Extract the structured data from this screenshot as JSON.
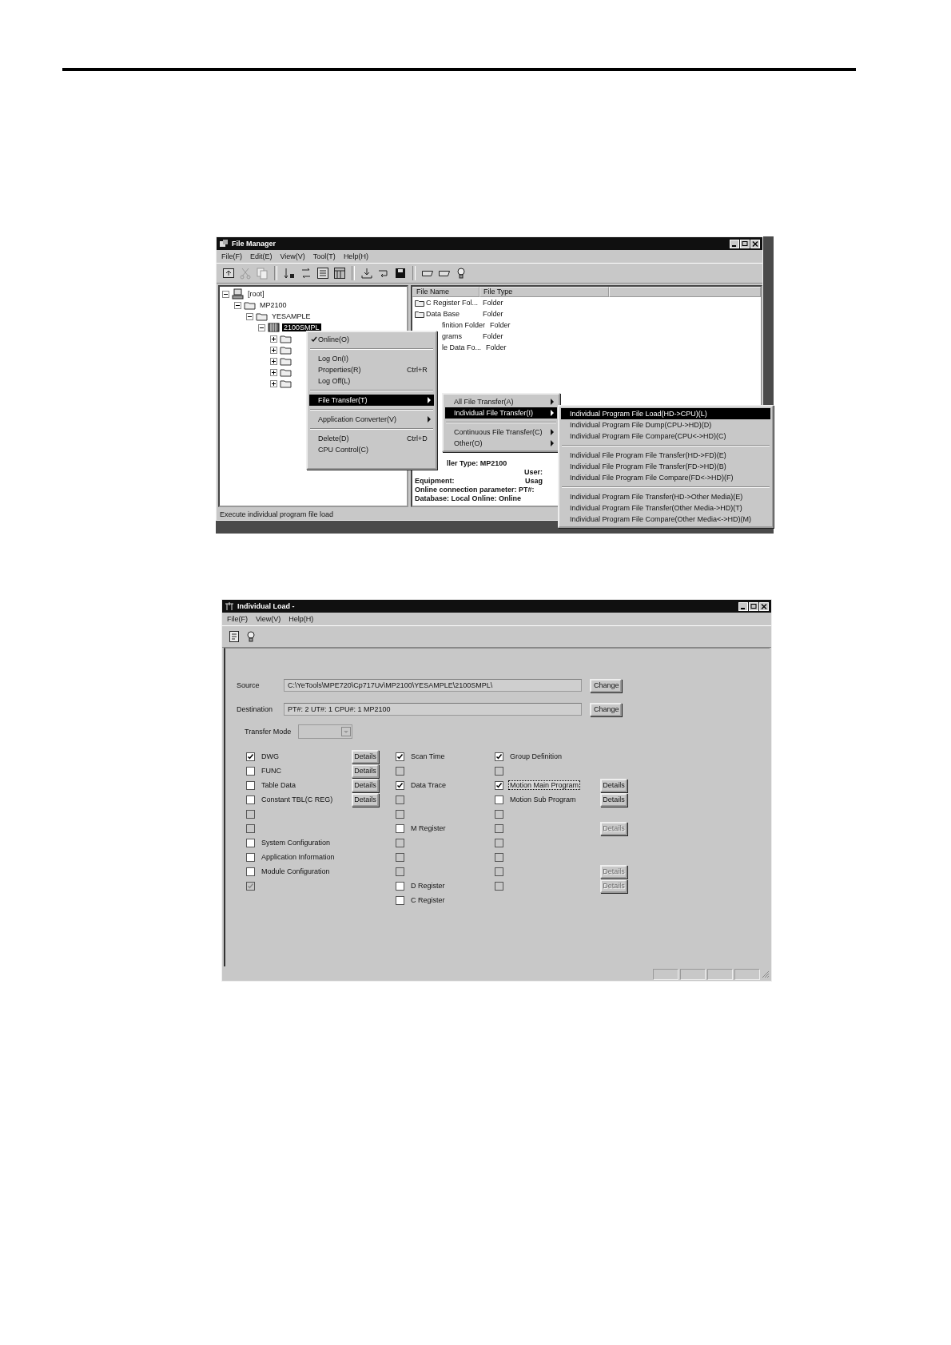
{
  "file_manager": {
    "title": "File Manager",
    "menus": [
      "File(F)",
      "Edit(E)",
      "View(V)",
      "Tool(T)",
      "Help(H)"
    ],
    "tree": [
      {
        "label": "[root]",
        "kind": "computer",
        "expanded": true,
        "children": [
          {
            "label": "MP2100",
            "kind": "folder",
            "expanded": true,
            "children": [
              {
                "label": "YESAMPLE",
                "kind": "folder",
                "expanded": true,
                "children": [
                  {
                    "label": "2100SMPL",
                    "kind": "controller",
                    "selected": true,
                    "expanded": true,
                    "children": [
                      {
                        "kind": "folder",
                        "expanded": false
                      },
                      {
                        "kind": "folder",
                        "expanded": false
                      },
                      {
                        "kind": "folder",
                        "expanded": false
                      },
                      {
                        "kind": "folder",
                        "expanded": false
                      },
                      {
                        "kind": "folder",
                        "expanded": false
                      }
                    ]
                  }
                ]
              }
            ]
          }
        ]
      }
    ],
    "list": {
      "columns": [
        "File Name",
        "File Type"
      ],
      "rows": [
        {
          "name": "C Register Fol...",
          "type": "Folder",
          "kind": "full"
        },
        {
          "name": "Data Base",
          "type": "Folder",
          "kind": "full"
        },
        {
          "name": "finition Folder",
          "type": "Folder",
          "kind": "partial"
        },
        {
          "name": "grams",
          "type": "Folder",
          "kind": "partial"
        },
        {
          "name": "le Data Fo...",
          "type": "Folder",
          "kind": "partial"
        }
      ],
      "info": [
        {
          "left": "ller Type: MP2100",
          "kind": "partial"
        },
        {
          "right": "User:",
          "kind": "partial"
        },
        {
          "left": "Equipment:",
          "right": "Usag",
          "kind": "full"
        },
        {
          "left": "Online connection parameter: PT#:",
          "kind": "full"
        },
        {
          "left": "Database: Local  Online: Online",
          "kind": "full"
        }
      ]
    },
    "context_menu": [
      {
        "kind": "item",
        "label": "Online(O)",
        "checked": true,
        "selected": false
      },
      {
        "kind": "separator"
      },
      {
        "kind": "item",
        "label": "Log On(I)",
        "checked": false,
        "selected": false
      },
      {
        "kind": "item",
        "label": "Properties(R)",
        "shortcut": "Ctrl+R",
        "checked": false,
        "selected": false
      },
      {
        "kind": "item",
        "label": "Log Off(L)",
        "checked": false,
        "selected": false
      },
      {
        "kind": "separator"
      },
      {
        "kind": "submenu",
        "label": "File Transfer(T)",
        "selected": true
      },
      {
        "kind": "separator"
      },
      {
        "kind": "submenu",
        "label": "Application Converter(V)",
        "selected": false
      },
      {
        "kind": "separator"
      },
      {
        "kind": "item",
        "label": "Delete(D)",
        "shortcut": "Ctrl+D",
        "checked": false,
        "selected": false
      },
      {
        "kind": "item",
        "label": "CPU Control(C)",
        "checked": false,
        "selected": false
      },
      {
        "kind": "blank"
      }
    ],
    "transfer_menu": [
      {
        "kind": "submenu",
        "label": "All File Transfer(A)",
        "selected": false
      },
      {
        "kind": "submenu",
        "label": "Individual File Transfer(I)",
        "selected": true
      },
      {
        "kind": "separator"
      },
      {
        "kind": "submenu",
        "label": "Continuous File Transfer(C)",
        "selected": false
      },
      {
        "kind": "submenu",
        "label": "Other(O)",
        "selected": false
      }
    ],
    "individual_menu": [
      {
        "kind": "item",
        "label": "Individual Program File Load(HD->CPU)(L)",
        "selected": true
      },
      {
        "kind": "item",
        "label": "Individual Program File Dump(CPU->HD)(D)",
        "selected": false
      },
      {
        "kind": "item",
        "label": "Individual Program File Compare(CPU<->HD)(C)",
        "selected": false
      },
      {
        "kind": "separator"
      },
      {
        "kind": "item",
        "label": "Individual File Program File Transfer(HD->FD)(E)",
        "selected": false
      },
      {
        "kind": "item",
        "label": "Individual File Program File Transfer(FD->HD)(B)",
        "selected": false
      },
      {
        "kind": "item",
        "label": "Individual File Program File Compare(FD<->HD)(F)",
        "selected": false
      },
      {
        "kind": "separator"
      },
      {
        "kind": "item",
        "label": "Individual Program File Transfer(HD->Other Media)(E)",
        "selected": false
      },
      {
        "kind": "item",
        "label": "Individual Program File Transfer(Other Media->HD)(T)",
        "selected": false
      },
      {
        "kind": "item",
        "label": "Individual Program File Compare(Other Media<->HD)(M)",
        "selected": false
      }
    ],
    "status_bar": "Execute individual program file load"
  },
  "individual_load": {
    "title": "Individual Load -",
    "menus": [
      "File(F)",
      "View(V)",
      "Help(H)"
    ],
    "source": {
      "label": "Source",
      "value": "C:\\YeTools\\MPE720\\Cp717Uv\\MP2100\\YESAMPLE\\2100SMPL\\",
      "button": "Change"
    },
    "destination": {
      "label": "Destination",
      "value": "PT#: 2 UT#: 1 CPU#: 1    MP2100",
      "button": "Change"
    },
    "transfer_mode": {
      "label": "Transfer Mode",
      "disabled": true
    },
    "columns": [
      [
        {
          "label": "DWG",
          "checked": true,
          "disabled": false,
          "focused": false,
          "details": {
            "label": "Details",
            "disabled": false
          }
        },
        {
          "label": "FUNC",
          "checked": false,
          "disabled": false,
          "focused": false,
          "details": {
            "label": "Details",
            "disabled": false
          }
        },
        {
          "label": "Table Data",
          "checked": false,
          "disabled": false,
          "focused": false,
          "details": {
            "label": "Details",
            "disabled": false
          }
        },
        {
          "label": "Constant TBL(C REG)",
          "checked": false,
          "disabled": false,
          "focused": false,
          "details": {
            "label": "Details",
            "disabled": false
          }
        },
        {
          "checked": false,
          "disabled": true,
          "focused": false
        },
        {
          "checked": false,
          "disabled": true,
          "focused": false
        },
        {
          "label": "System Configuration",
          "checked": false,
          "disabled": false,
          "focused": false
        },
        {
          "label": "Application Information",
          "checked": false,
          "disabled": false,
          "focused": false
        },
        {
          "label": "Module Configuration",
          "checked": false,
          "disabled": false,
          "focused": false
        },
        {
          "checked": true,
          "disabled": true,
          "focused": false
        }
      ],
      [
        {
          "label": "Scan Time",
          "checked": true,
          "disabled": false,
          "focused": false
        },
        {
          "checked": false,
          "disabled": true,
          "focused": false
        },
        {
          "label": "Data Trace",
          "checked": true,
          "disabled": false,
          "focused": false
        },
        {
          "checked": false,
          "disabled": true,
          "focused": false
        },
        {
          "checked": false,
          "disabled": true,
          "focused": false
        },
        {
          "label": "M Register",
          "checked": false,
          "disabled": false,
          "focused": false
        },
        {
          "checked": false,
          "disabled": true,
          "focused": false
        },
        {
          "checked": false,
          "disabled": true,
          "focused": false
        },
        {
          "checked": false,
          "disabled": true,
          "focused": false
        },
        {
          "label": "D Register",
          "checked": false,
          "disabled": false,
          "focused": false
        },
        {
          "label": "C Register",
          "checked": false,
          "disabled": false,
          "focused": false
        }
      ],
      [
        {
          "label": "Group Definition",
          "checked": true,
          "disabled": false,
          "focused": false
        },
        {
          "checked": false,
          "disabled": true,
          "focused": false
        },
        {
          "label": "Motion Main Program",
          "checked": true,
          "disabled": false,
          "focused": true,
          "details": {
            "label": "Details",
            "disabled": false
          }
        },
        {
          "label": "Motion Sub Program",
          "checked": false,
          "disabled": false,
          "focused": false,
          "details": {
            "label": "Details",
            "disabled": false
          }
        },
        {
          "checked": false,
          "disabled": true,
          "focused": false
        },
        {
          "checked": false,
          "disabled": true,
          "focused": false,
          "details": {
            "label": "Details",
            "disabled": true
          }
        },
        {
          "checked": false,
          "disabled": true,
          "focused": false
        },
        {
          "checked": false,
          "disabled": true,
          "focused": false
        },
        {
          "checked": false,
          "disabled": true,
          "focused": false,
          "details": {
            "label": "Details",
            "disabled": true
          }
        },
        {
          "checked": false,
          "disabled": true,
          "focused": false,
          "details": {
            "label": "Details",
            "disabled": true
          }
        }
      ]
    ]
  }
}
